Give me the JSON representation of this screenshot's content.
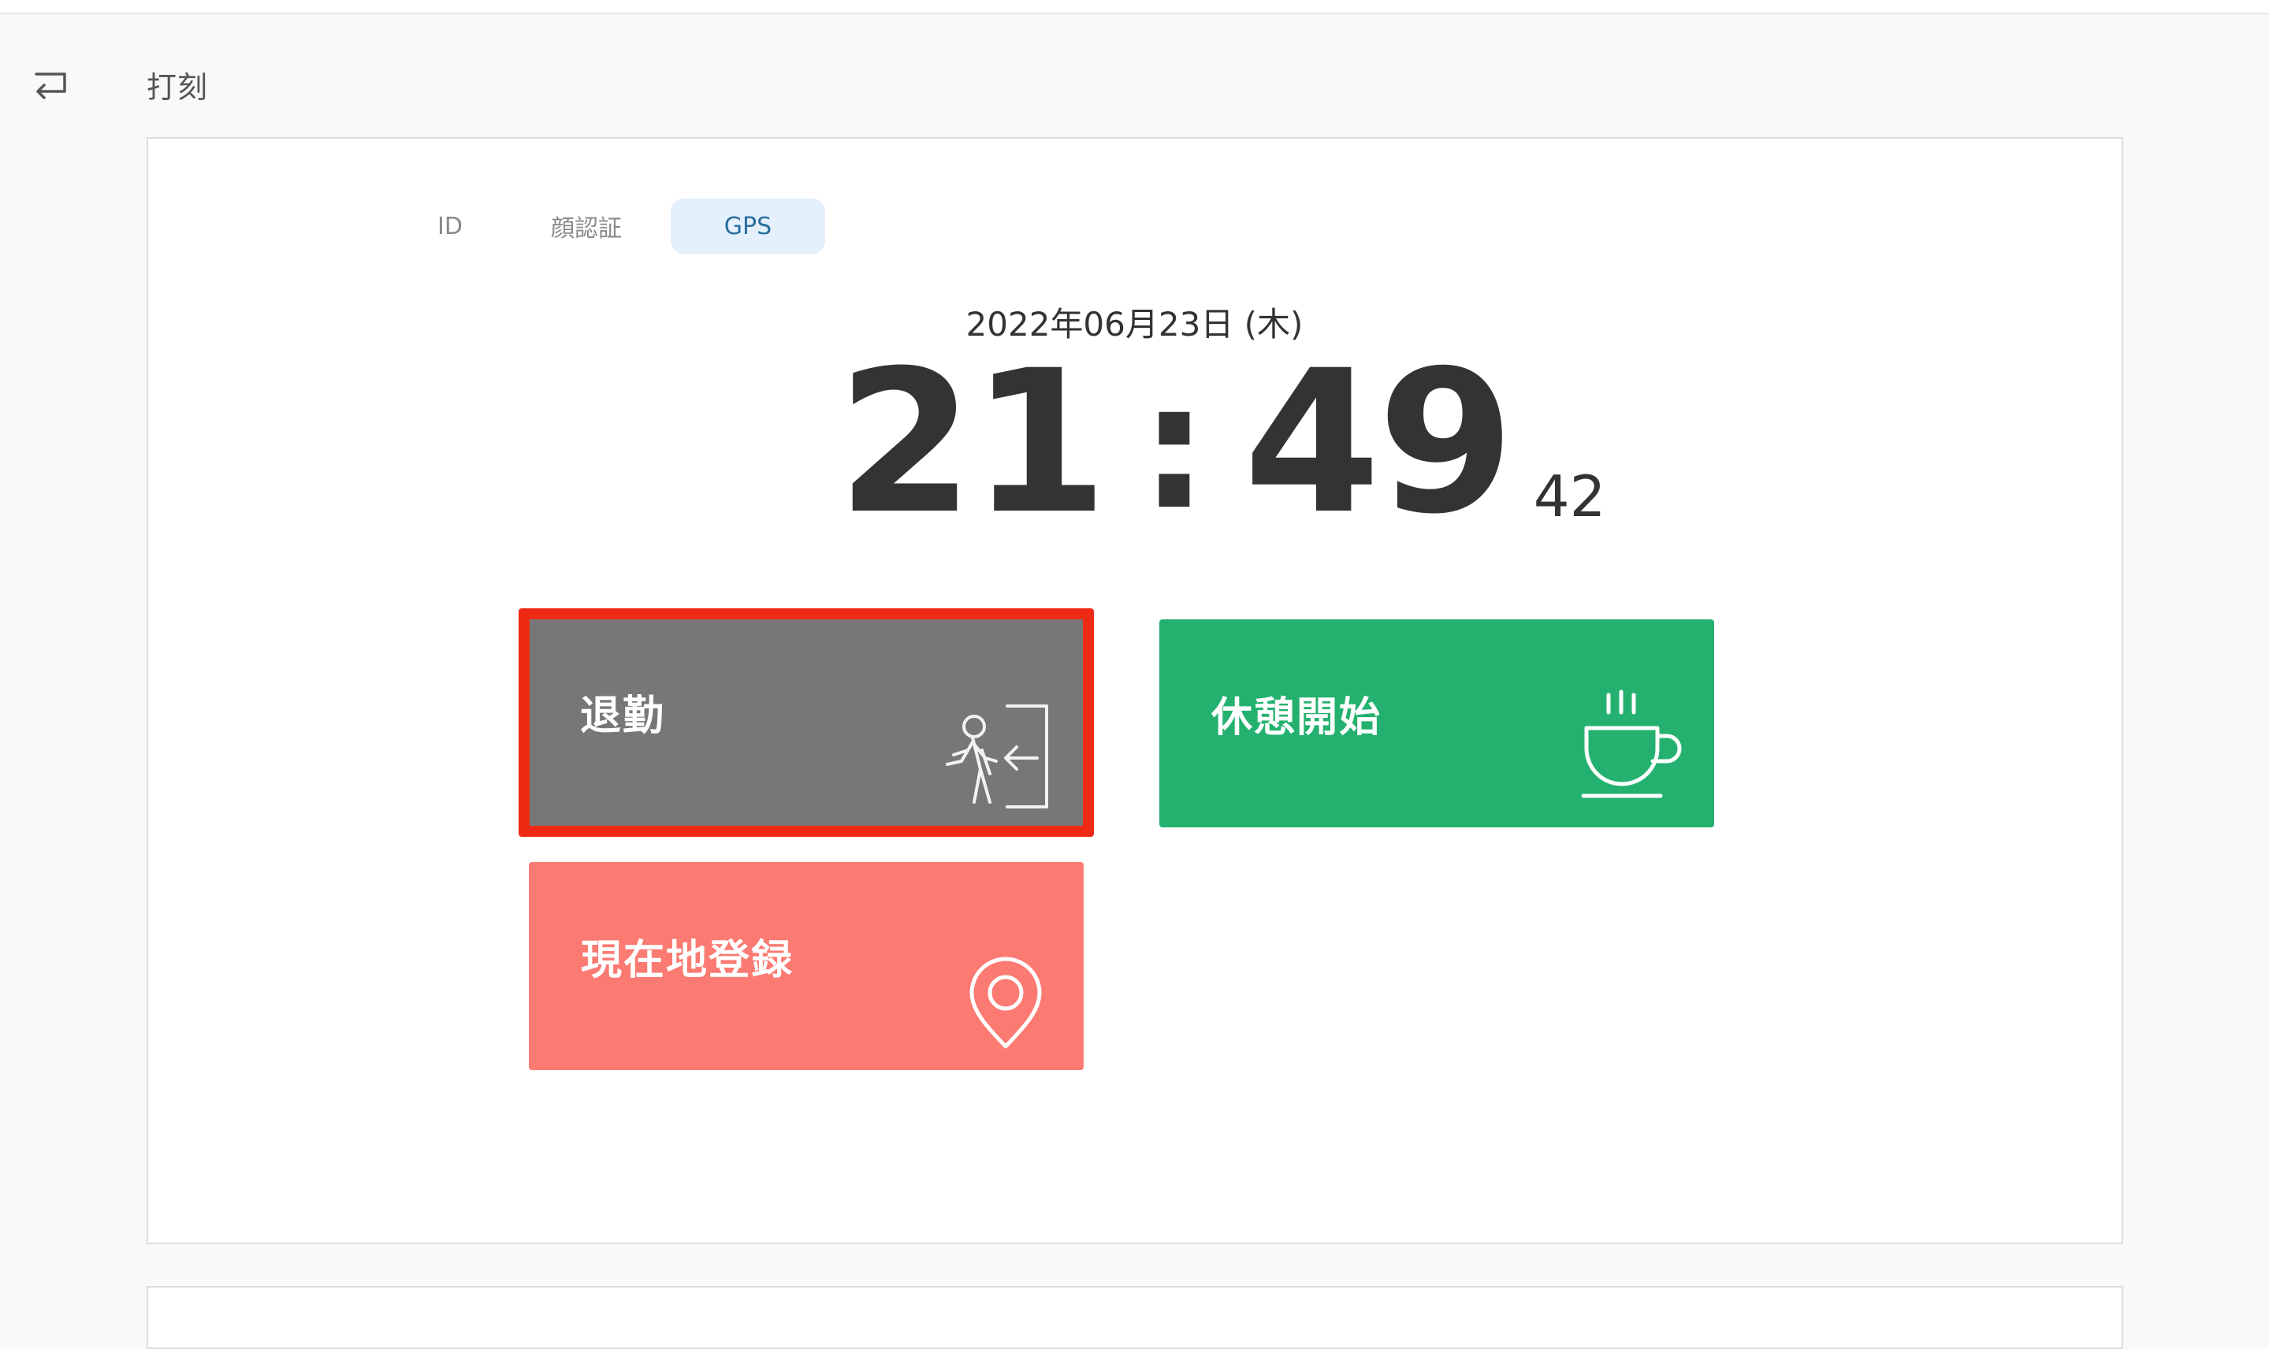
{
  "header": {
    "back_icon": "return-icon",
    "title": "打刻"
  },
  "tabs": [
    {
      "label": "ID",
      "active": false
    },
    {
      "label": "顔認証",
      "active": false
    },
    {
      "label": "GPS",
      "active": true
    }
  ],
  "clock": {
    "date": "2022年06月23日 (木)",
    "hours": "21",
    "separator": ":",
    "minutes": "49",
    "seconds": "42"
  },
  "actions": {
    "leave": {
      "label": "退勤",
      "icon": "exit-person-icon",
      "color": "#777777",
      "highlight_color": "#ef2a14"
    },
    "break_start": {
      "label": "休憩開始",
      "icon": "coffee-cup-icon",
      "color": "#24b16f"
    },
    "register_location": {
      "label": "現在地登録",
      "icon": "location-pin-icon",
      "color": "#fb7a72"
    }
  },
  "colors": {
    "tab_active_bg": "#e4f0fb",
    "tab_active_text": "#2a6f9e"
  }
}
